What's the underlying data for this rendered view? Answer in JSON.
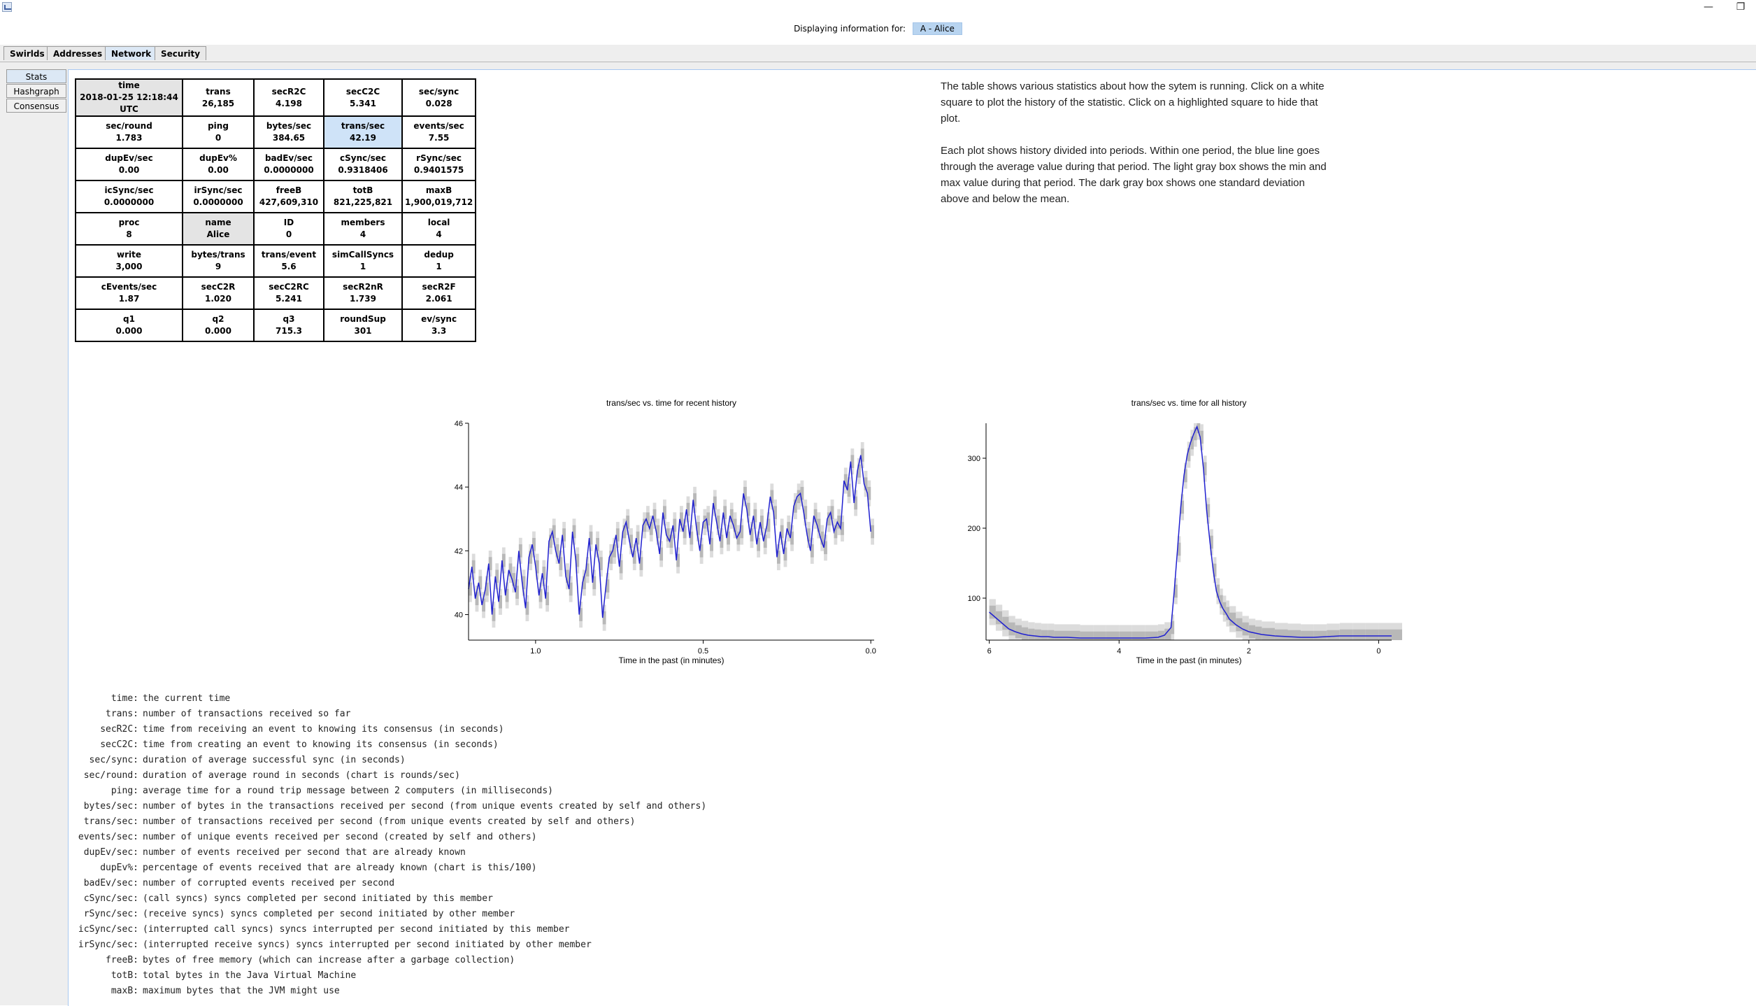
{
  "window": {
    "minimize": "—",
    "restore": "❐"
  },
  "header": {
    "label": "Displaying information for:",
    "member": "A - Alice"
  },
  "tabs": [
    "Swirlds",
    "Addresses",
    "Network",
    "Security"
  ],
  "active_tab": "Network",
  "side_tabs": [
    "Stats",
    "Hashgraph",
    "Consensus"
  ],
  "active_side_tab": "Stats",
  "stats": [
    [
      {
        "name": "time",
        "value": "2018-01-25 12:18:44 UTC",
        "state": "selected"
      },
      {
        "name": "trans",
        "value": "26,185"
      },
      {
        "name": "secR2C",
        "value": "4.198"
      },
      {
        "name": "secC2C",
        "value": "5.341"
      },
      {
        "name": "sec/sync",
        "value": "0.028"
      }
    ],
    [
      {
        "name": "sec/round",
        "value": "1.783"
      },
      {
        "name": "ping",
        "value": "0"
      },
      {
        "name": "bytes/sec",
        "value": "384.65"
      },
      {
        "name": "trans/sec",
        "value": "42.19",
        "state": "plotted"
      },
      {
        "name": "events/sec",
        "value": "7.55"
      }
    ],
    [
      {
        "name": "dupEv/sec",
        "value": "0.00"
      },
      {
        "name": "dupEv%",
        "value": "0.00"
      },
      {
        "name": "badEv/sec",
        "value": "0.0000000"
      },
      {
        "name": "cSync/sec",
        "value": "0.9318406"
      },
      {
        "name": "rSync/sec",
        "value": "0.9401575"
      }
    ],
    [
      {
        "name": "icSync/sec",
        "value": "0.0000000"
      },
      {
        "name": "irSync/sec",
        "value": "0.0000000"
      },
      {
        "name": "freeB",
        "value": "427,609,310"
      },
      {
        "name": "totB",
        "value": "821,225,821"
      },
      {
        "name": "maxB",
        "value": "1,900,019,712"
      }
    ],
    [
      {
        "name": "proc",
        "value": "8"
      },
      {
        "name": "name",
        "value": "Alice",
        "state": "selected"
      },
      {
        "name": "ID",
        "value": "0"
      },
      {
        "name": "members",
        "value": "4"
      },
      {
        "name": "local",
        "value": "4"
      }
    ],
    [
      {
        "name": "write",
        "value": "3,000"
      },
      {
        "name": "bytes/trans",
        "value": "9"
      },
      {
        "name": "trans/event",
        "value": "5.6"
      },
      {
        "name": "simCallSyncs",
        "value": "1"
      },
      {
        "name": "dedup",
        "value": "1"
      }
    ],
    [
      {
        "name": "cEvents/sec",
        "value": "1.87"
      },
      {
        "name": "secC2R",
        "value": "1.020"
      },
      {
        "name": "secC2RC",
        "value": "5.241"
      },
      {
        "name": "secR2nR",
        "value": "1.739"
      },
      {
        "name": "secR2F",
        "value": "2.061"
      }
    ],
    [
      {
        "name": "q1",
        "value": "0.000"
      },
      {
        "name": "q2",
        "value": "0.000"
      },
      {
        "name": "q3",
        "value": "715.3"
      },
      {
        "name": "roundSup",
        "value": "301"
      },
      {
        "name": "ev/sync",
        "value": "3.3"
      }
    ]
  ],
  "info": {
    "p1": "The table shows various statistics about how the sytem is running. Click on a white square to plot the history of the statistic. Click on a highlighted square to hide that plot.",
    "p2": "Each plot shows history divided into periods. Within one period, the blue line goes through the average value during that period. The light gray box shows the min and max value during that period. The dark gray box shows one standard deviation above and below the mean."
  },
  "chart_data": [
    {
      "type": "line",
      "title": "trans/sec vs. time for recent history",
      "xlabel": "Time in the past (in minutes)",
      "ylabel": "",
      "xlim": [
        1.2,
        -0.01
      ],
      "ylim": [
        39.2,
        46.0
      ],
      "xticks": [
        "1.0",
        "0.5",
        "0.0"
      ],
      "xtick_values": [
        1.0,
        0.5,
        0.0
      ],
      "yticks": [
        "40",
        "42",
        "44",
        "46"
      ],
      "ytick_values": [
        40,
        42,
        44,
        46
      ],
      "line_color": "#2020d0",
      "band_colors": {
        "minmax": "#dcdcdc",
        "stddev": "#b8b8b8"
      },
      "series": [
        {
          "x": [
            1.2,
            1.19,
            1.18,
            1.17,
            1.16,
            1.15,
            1.14,
            1.13,
            1.12,
            1.11,
            1.1,
            1.09,
            1.08,
            1.07,
            1.06,
            1.05,
            1.04,
            1.03,
            1.02,
            1.01,
            1.0,
            0.99,
            0.98,
            0.97,
            0.96,
            0.95,
            0.94,
            0.93,
            0.92,
            0.91,
            0.9,
            0.89,
            0.88,
            0.87,
            0.86,
            0.85,
            0.84,
            0.83,
            0.82,
            0.81,
            0.8,
            0.79,
            0.78,
            0.77,
            0.76,
            0.75,
            0.74,
            0.73,
            0.72,
            0.71,
            0.7,
            0.69,
            0.68,
            0.67,
            0.66,
            0.65,
            0.64,
            0.63,
            0.62,
            0.61,
            0.6,
            0.59,
            0.58,
            0.57,
            0.56,
            0.55,
            0.54,
            0.53,
            0.52,
            0.51,
            0.5,
            0.49,
            0.48,
            0.47,
            0.46,
            0.45,
            0.44,
            0.43,
            0.42,
            0.41,
            0.4,
            0.39,
            0.38,
            0.37,
            0.36,
            0.35,
            0.34,
            0.33,
            0.32,
            0.31,
            0.3,
            0.29,
            0.28,
            0.27,
            0.26,
            0.25,
            0.24,
            0.23,
            0.22,
            0.21,
            0.2,
            0.19,
            0.18,
            0.17,
            0.16,
            0.15,
            0.14,
            0.13,
            0.12,
            0.11,
            0.1,
            0.09,
            0.08,
            0.07,
            0.06,
            0.05,
            0.04,
            0.03,
            0.02,
            0.01,
            0.0
          ],
          "y": [
            40.8,
            41.5,
            40.5,
            41.0,
            40.3,
            40.8,
            41.6,
            40.0,
            41.2,
            40.4,
            41.7,
            40.6,
            41.4,
            41.1,
            40.7,
            42.0,
            41.0,
            40.2,
            41.8,
            42.2,
            41.5,
            40.6,
            41.3,
            40.5,
            42.3,
            42.6,
            42.0,
            41.6,
            42.5,
            41.2,
            40.8,
            42.6,
            41.7,
            40.0,
            41.0,
            41.4,
            42.4,
            41.0,
            42.2,
            41.6,
            39.9,
            40.9,
            41.8,
            42.0,
            42.5,
            41.5,
            42.6,
            42.9,
            42.3,
            41.8,
            42.4,
            41.6,
            42.8,
            43.0,
            42.7,
            43.1,
            42.6,
            41.9,
            43.2,
            42.5,
            42.3,
            42.8,
            41.7,
            43.0,
            42.6,
            43.3,
            42.4,
            43.6,
            42.7,
            42.0,
            42.9,
            43.0,
            42.2,
            43.5,
            42.9,
            42.3,
            43.2,
            42.4,
            43.1,
            42.8,
            42.4,
            42.6,
            43.8,
            43.3,
            42.5,
            43.1,
            42.2,
            42.9,
            42.3,
            42.8,
            43.7,
            43.2,
            41.8,
            42.6,
            41.9,
            42.7,
            42.4,
            43.4,
            43.7,
            43.8,
            43.2,
            42.5,
            42.0,
            43.1,
            42.8,
            42.4,
            42.1,
            43.0,
            43.2,
            42.6,
            42.9,
            42.7,
            44.2,
            43.9,
            44.8,
            43.5,
            44.5,
            45.0,
            44.1,
            43.8,
            42.6
          ]
        }
      ]
    },
    {
      "type": "line",
      "title": "trans/sec vs. time for all history",
      "xlabel": "Time in the past (in minutes)",
      "ylabel": "",
      "xlim": [
        6.05,
        -0.2
      ],
      "ylim": [
        40,
        350
      ],
      "xticks": [
        "6",
        "4",
        "2",
        "0"
      ],
      "xtick_values": [
        6,
        4,
        2,
        0
      ],
      "yticks": [
        "100",
        "200",
        "300"
      ],
      "ytick_values": [
        100,
        200,
        300
      ],
      "line_color": "#2020d0",
      "band_colors": {
        "minmax": "#dcdcdc",
        "stddev": "#b8b8b8"
      },
      "series": [
        {
          "x": [
            6.0,
            5.9,
            5.8,
            5.7,
            5.6,
            5.5,
            5.4,
            5.3,
            5.2,
            5.1,
            5.0,
            4.8,
            4.6,
            4.4,
            4.2,
            4.0,
            3.8,
            3.6,
            3.4,
            3.3,
            3.2,
            3.15,
            3.1,
            3.05,
            3.0,
            2.95,
            2.9,
            2.85,
            2.8,
            2.75,
            2.7,
            2.65,
            2.6,
            2.55,
            2.5,
            2.45,
            2.4,
            2.35,
            2.3,
            2.2,
            2.1,
            2.0,
            1.9,
            1.8,
            1.6,
            1.4,
            1.2,
            1.0,
            0.8,
            0.6,
            0.4,
            0.2,
            0.0,
            -0.2
          ],
          "y": [
            80,
            72,
            64,
            56,
            52,
            49,
            47,
            46,
            45,
            45,
            44,
            44,
            43,
            43,
            43,
            43,
            43,
            43,
            44,
            47,
            58,
            110,
            170,
            230,
            275,
            305,
            322,
            335,
            345,
            330,
            285,
            225,
            180,
            140,
            110,
            95,
            85,
            78,
            70,
            62,
            56,
            52,
            50,
            48,
            46,
            45,
            44,
            44,
            45,
            46,
            46,
            46,
            46,
            46
          ]
        }
      ]
    }
  ],
  "descriptions": [
    {
      "name": "time:",
      "text": "the current time"
    },
    {
      "name": "trans:",
      "text": "number of transactions received so far"
    },
    {
      "name": "secR2C:",
      "text": "time from receiving an event to knowing its consensus (in seconds)"
    },
    {
      "name": "secC2C:",
      "text": "time from creating an event to knowing its consensus (in seconds)"
    },
    {
      "name": "sec/sync:",
      "text": "duration of average successful sync (in seconds)"
    },
    {
      "name": "sec/round:",
      "text": "duration of average round in seconds (chart is rounds/sec)"
    },
    {
      "name": "ping:",
      "text": "average time for a round trip message between 2 computers (in milliseconds)"
    },
    {
      "name": "bytes/sec:",
      "text": "number of bytes in the transactions received per second (from unique events created by self and others)"
    },
    {
      "name": "trans/sec:",
      "text": "number of transactions received per second (from unique events created by self and others)"
    },
    {
      "name": "events/sec:",
      "text": "number of unique events received per second (created by self and others)"
    },
    {
      "name": "dupEv/sec:",
      "text": "number of events received per second that are already known"
    },
    {
      "name": "dupEv%:",
      "text": "percentage of events received that are already known (chart is this/100)"
    },
    {
      "name": "badEv/sec:",
      "text": "number of corrupted events received per second"
    },
    {
      "name": "cSync/sec:",
      "text": "(call syncs) syncs completed per second initiated by this member"
    },
    {
      "name": "rSync/sec:",
      "text": "(receive syncs) syncs completed per second initiated by other member"
    },
    {
      "name": "icSync/sec:",
      "text": "(interrupted call syncs) syncs interrupted per second initiated by this member"
    },
    {
      "name": "irSync/sec:",
      "text": "(interrupted receive syncs) syncs interrupted per second initiated by other member"
    },
    {
      "name": "freeB:",
      "text": "bytes of free memory (which can increase after a garbage collection)"
    },
    {
      "name": "totB:",
      "text": "total bytes in the Java Virtual Machine"
    },
    {
      "name": "maxB:",
      "text": "maximum bytes that the JVM might use"
    }
  ]
}
